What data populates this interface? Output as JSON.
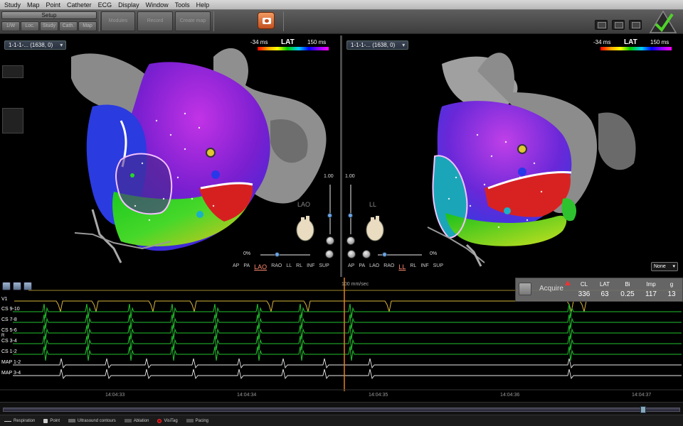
{
  "menu": [
    "Study",
    "Map",
    "Point",
    "Catheter",
    "ECG",
    "Display",
    "Window",
    "Tools",
    "Help"
  ],
  "toolbar": {
    "setup_label": "Setup",
    "small_buttons": [
      "1/W",
      "Loc.",
      "Study",
      "Cath.",
      "Map"
    ],
    "big_buttons": [
      "Modules",
      "Record",
      "Create map"
    ],
    "camera_icon": "camera-icon",
    "status_icons": [
      "monitor-icon",
      "camera-view-icon",
      "heart-icon"
    ],
    "logo_icon": "checkmark-triangle-icon"
  },
  "maps": {
    "left": {
      "title": "1-1-1-... (1638, 0)",
      "lat_min": "-34 ms",
      "lat_title": "LAT",
      "lat_max": "150 ms",
      "view_name": "LAO",
      "zoom_value": "1.00",
      "opacity_value": "0%",
      "views": [
        "AP",
        "PA",
        "LAO",
        "RAO",
        "LL",
        "RL",
        "INF",
        "SUP"
      ],
      "active_view": "LAO"
    },
    "right": {
      "title": "1-1-1-... (1638, 0)",
      "lat_min": "-34 ms",
      "lat_title": "LAT",
      "lat_max": "150 ms",
      "view_name": "LL",
      "zoom_value": "1.00",
      "opacity_value": "0%",
      "views": [
        "AP",
        "PA",
        "LAO",
        "RAO",
        "LL",
        "RL",
        "INF",
        "SUP"
      ],
      "active_view": "LL",
      "dropdown_value": "None"
    }
  },
  "ecg": {
    "sweep_speed": "100 mm/sec",
    "channels": [
      "V1",
      "CS 9-10",
      "CS 7-8",
      "CS 5-6",
      "R",
      "CS 3-4",
      "CS 1-2",
      "MAP 1-2",
      "MAP 3-4"
    ],
    "times": [
      "14:04:33",
      "14:04:34",
      "14:04:35",
      "14:04:36",
      "14:04:37"
    ],
    "acquire": {
      "label": "Acquire",
      "fields": [
        {
          "name": "CL",
          "value": "336"
        },
        {
          "name": "LAT",
          "value": "63"
        },
        {
          "name": "Bi",
          "value": "0.25"
        },
        {
          "name": "Imp",
          "value": "117"
        },
        {
          "name": "g",
          "value": "13"
        }
      ]
    }
  },
  "legend": [
    "Respiration",
    "Point",
    "Ultrasound contours",
    "Ablation",
    "VisiTag",
    "Pacing"
  ],
  "colors": {
    "ecg_green": "#22c22e",
    "ecg_yellow": "#d9b53a",
    "ecg_white": "#e8e8e8",
    "cursor_orange": "#e08020",
    "active_view": "#ff8a70"
  }
}
